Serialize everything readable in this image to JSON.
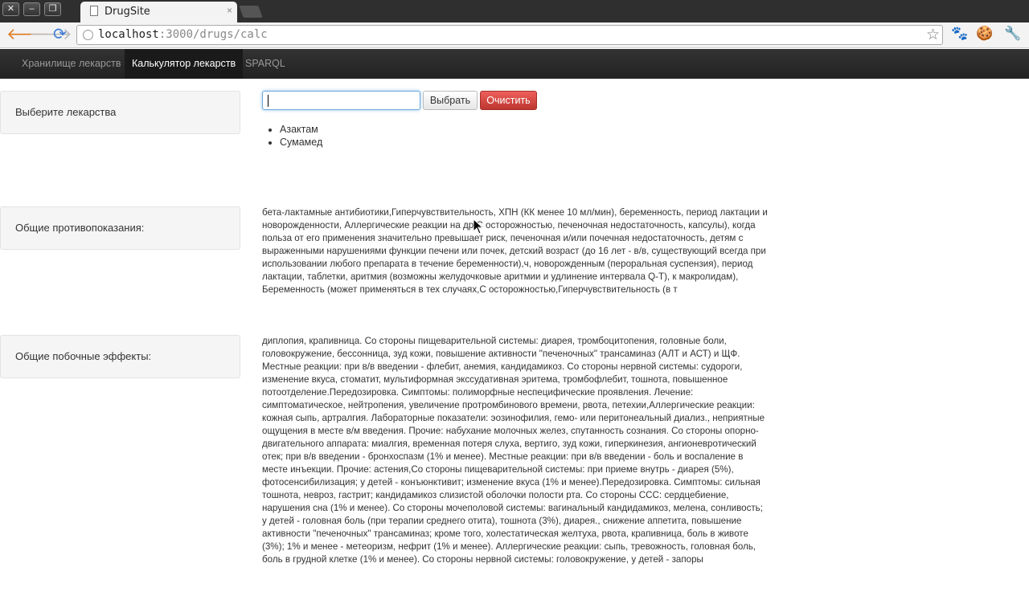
{
  "browser": {
    "tab_title": "DrugSite",
    "tab_close": "×",
    "url_host": "localhost",
    "url_path": ":3000/drugs/calc"
  },
  "navbar": {
    "items": [
      {
        "label": "Хранилище лекарств"
      },
      {
        "label": "Калькулятор лекарств"
      },
      {
        "label": "SPARQL"
      }
    ]
  },
  "select_section": {
    "label": "Выберите лекарства",
    "input_value": "",
    "select_button": "Выбрать",
    "clear_button": "Очистить",
    "selected_drugs": [
      "Азактам",
      "Сумамед"
    ]
  },
  "contraindications": {
    "label": "Общие противопоказания:",
    "text": "бета-лактамные антибиотики,Гиперчувствительность, ХПН (КК менее 10 мл/мин), беременность, период лактации и новорожденности, Аллергические реакции на др,С осторожностью, печеночная недостаточность, капсулы), когда польза от его применения значительно превышает риск, печеночная и/или почечная недостаточность, детям с выраженными нарушениями функции печени или почек, детский возраст (до 16 лет - в/в, существующий всегда при использовании любого препарата в течение беременности),ч, новорожденным (пероральная суспензия), период лактации, таблетки, аритмия (возможны желудочковые аритмии и удлинение интервала Q-T), к макролидам), Беременность (может применяться в тех случаях,С осторожностью,Гиперчувствительность (в т"
  },
  "side_effects": {
    "label": "Общие побочные эффекты:",
    "text": "диплопия, крапивница. Со стороны пищеварительной системы: диарея, тромбоцитопения, головные боли, головокружение, бессонница, зуд кожи, повышение активности \"печеночных\" трансаминаз (АЛТ и АСТ) и ЩФ. Местные реакции: при в/в введении - флебит, анемия, кандидамикоз. Со стороны нервной системы: судороги, изменение вкуса, стоматит, мультиформная экссудативная эритема, тромбофлебит, тошнота, повышенное потоотделение.Передозировка. Симптомы: полиморфные неспецифические проявления. Лечение: симптоматическое, нейтропения, увеличение протромбинового времени, рвота, петехии,Аллергические реакции: кожная сыпь, артралгия. Лабораторные показатели: эозинофилия, гемо- или перитонеальный диализ., неприятные ощущения в месте в/м введения. Прочие: набухание молочных желез, спутанность сознания. Со стороны опорно-двигательного аппарата: миалгия, временная потеря слуха, вертиго, зуд кожи, гиперкинезия, ангионевротический отек; при в/в введении - бронхоспазм (1% и менее). Местные реакции: при в/в введении - боль и воспаление в месте инъекции. Прочие: астения,Со стороны пищеварительной системы: при приеме внутрь - диарея (5%), фотосенсибилизация; у детей - конъюнктивит; изменение вкуса (1% и менее).Передозировка. Симптомы: сильная тошнота, невроз, гастрит; кандидамикоз слизистой оболочки полости рта. Со стороны ССС: сердцебиение, нарушения сна (1% и менее). Со стороны мочеполовой системы: вагинальный кандидамикоз, мелена, сонливость; у детей - головная боль (при терапии среднего отита), тошнота (3%), диарея., снижение аппетита, повышение активности \"печеночных\" трансаминаз; кроме того, холестатическая желтуха, рвота, крапивница, боль в животе (3%); 1% и менее - метеоризм, нефрит (1% и менее). Аллергические реакции: сыпь, тревожность, головная боль, боль в грудной клетке (1% и менее). Со стороны нервной системы: головокружение, у детей - запоры"
  }
}
